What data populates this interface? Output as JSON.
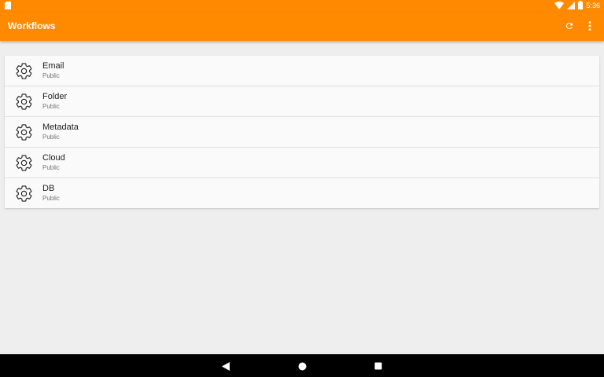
{
  "status_bar": {
    "time": "5:36"
  },
  "app_bar": {
    "title": "Workflows",
    "actions": [
      {
        "icon": "refresh-icon"
      },
      {
        "icon": "more-vert-icon"
      }
    ],
    "color": "#ff8a00"
  },
  "workflows": [
    {
      "title": "Email",
      "subtitle": "Public",
      "icon": "gear-icon"
    },
    {
      "title": "Folder",
      "subtitle": "Public",
      "icon": "gear-icon"
    },
    {
      "title": "Metadata",
      "subtitle": "Public",
      "icon": "gear-icon"
    },
    {
      "title": "Cloud",
      "subtitle": "Public",
      "icon": "gear-icon"
    },
    {
      "title": "DB",
      "subtitle": "Public",
      "icon": "gear-icon"
    }
  ],
  "nav_bar": {
    "buttons": [
      "back-icon",
      "home-icon",
      "recents-icon"
    ]
  }
}
